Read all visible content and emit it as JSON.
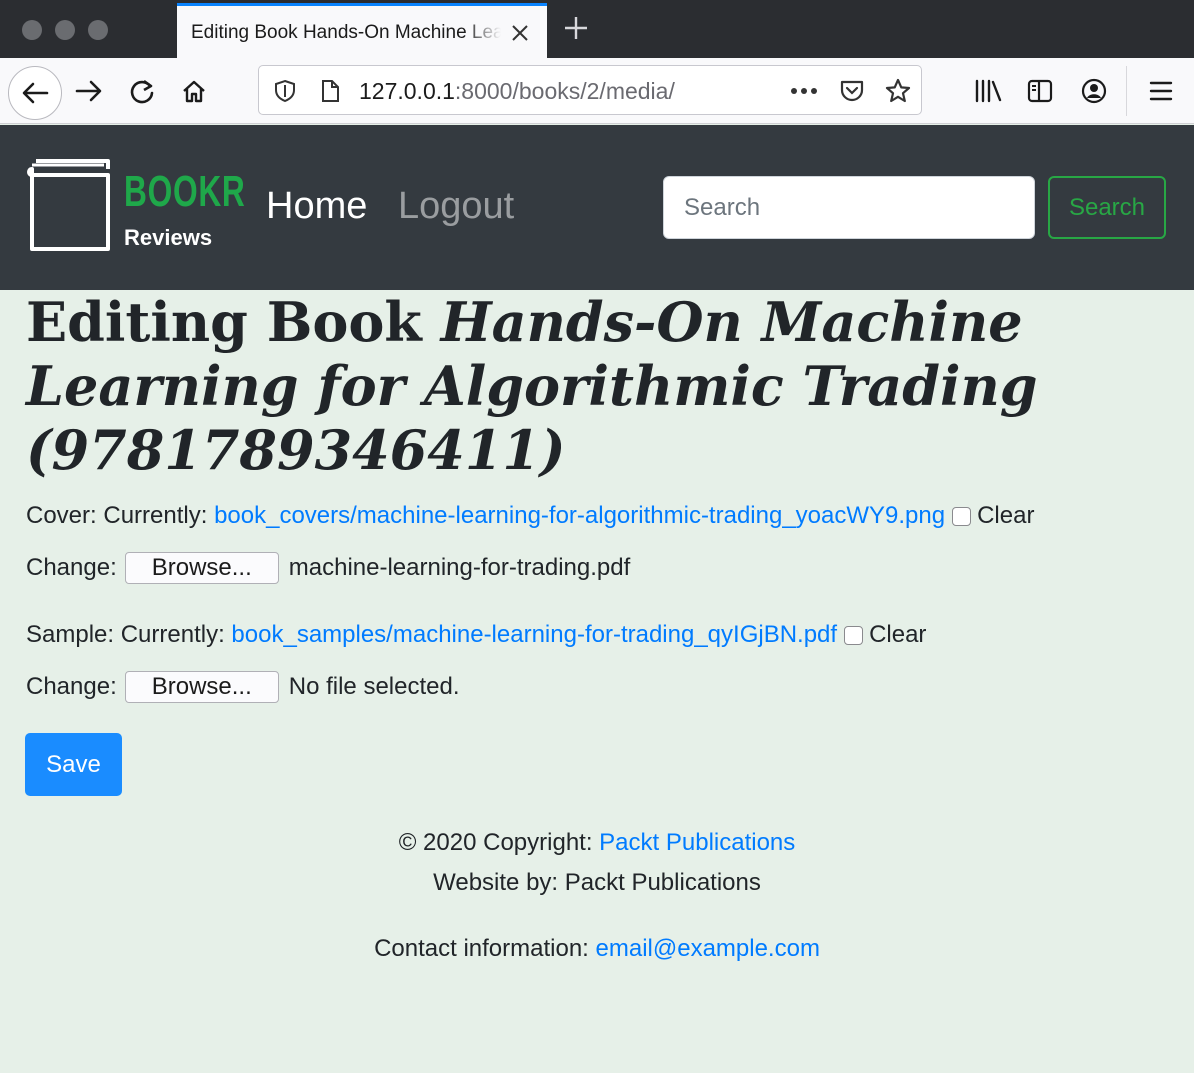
{
  "browser": {
    "tab_title": "Editing Book Hands-On Machine Learning for Algorithmic Trading",
    "url_host": "127.0.0.1",
    "url_rest": ":8000/books/2/media/"
  },
  "navbar": {
    "brand": "BOOKR",
    "brand_sub": "Reviews",
    "home": "Home",
    "logout": "Logout",
    "search_placeholder": "Search",
    "search_button": "Search"
  },
  "page": {
    "heading_prefix": "Editing Book ",
    "heading_title": "Hands-On Machine Learning for Algorithmic Trading (9781789346411)"
  },
  "form": {
    "cover": {
      "label": "Cover: Currently: ",
      "current_link": "book_covers/machine-learning-for-algorithmic-trading_yoacWY9.png",
      "clear_label": "Clear",
      "change_label": "Change:",
      "browse_label": "Browse...",
      "file_status": "machine-learning-for-trading.pdf"
    },
    "sample": {
      "label": "Sample: Currently: ",
      "current_link": "book_samples/machine-learning-for-trading_qyIGjBN.pdf",
      "clear_label": "Clear",
      "change_label": "Change:",
      "browse_label": "Browse...",
      "file_status": "No file selected."
    },
    "save_button": "Save"
  },
  "footer": {
    "copyright_prefix": "© 2020 Copyright: ",
    "copyright_link": "Packt Publications",
    "website_by": "Website by: Packt Publications",
    "contact_prefix": "Contact information: ",
    "contact_email": "email@example.com"
  },
  "colors": {
    "navbar_bg": "#343a40",
    "brand_green": "#1fa84a",
    "link_blue": "#007bff",
    "page_bg": "#e6f0e8",
    "save_blue": "#1a8cff"
  }
}
